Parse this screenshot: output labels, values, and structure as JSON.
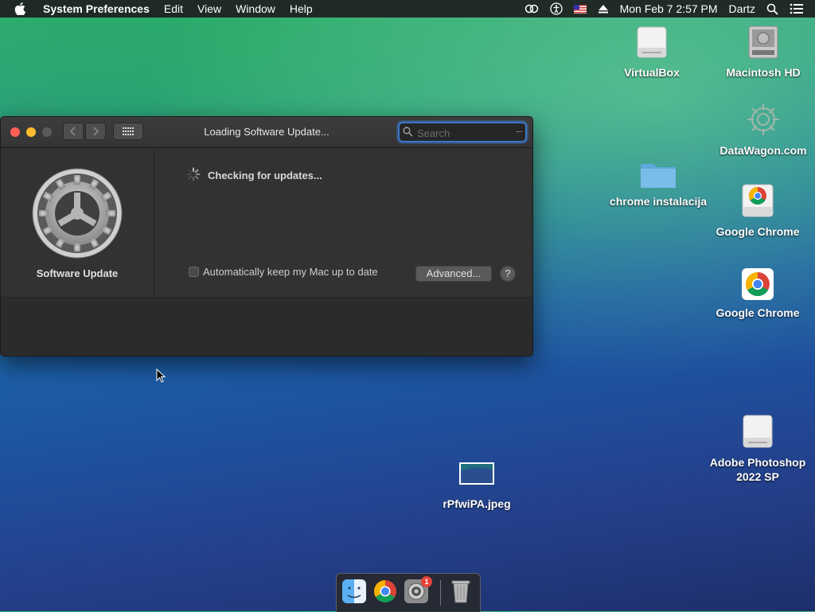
{
  "menubar": {
    "app_name": "System Preferences",
    "items": [
      "Edit",
      "View",
      "Window",
      "Help"
    ],
    "clock": "Mon Feb 7  2:57 PM",
    "user": "Dartz",
    "status_icons": [
      "creative-cloud-icon",
      "accessibility-icon",
      "us-flag-icon",
      "eject-icon",
      "search-icon",
      "list-icon"
    ]
  },
  "desktop": {
    "icons": [
      {
        "label": "VirtualBox",
        "icon": "drive-icon"
      },
      {
        "label": "Macintosh HD",
        "icon": "hard-disk-icon"
      },
      {
        "label": "DataWagon.com",
        "icon": "datawagon-icon"
      },
      {
        "label": "chrome instalacija",
        "icon": "folder-icon"
      },
      {
        "label": "Google Chrome",
        "icon": "chrome-drive-icon"
      },
      {
        "label": "Google Chrome",
        "icon": "chrome-icon"
      },
      {
        "label": "Adobe Photoshop 2022 SP",
        "icon": "drive-icon"
      },
      {
        "label": "rPfwiPA.jpeg",
        "icon": "image-file-icon"
      }
    ]
  },
  "window": {
    "title": "Loading Software Update...",
    "search": {
      "placeholder": "Search",
      "value": ""
    },
    "sidebar_label": "Software Update",
    "status_text": "Checking for updates...",
    "auto_update_label": "Automatically keep my Mac up to date",
    "auto_update_checked": false,
    "advanced_button": "Advanced...",
    "help_button": "?"
  },
  "dock": {
    "items": [
      "finder-icon",
      "chrome-icon",
      "system-preferences-icon",
      "trash-icon"
    ],
    "system_preferences_badge": "1"
  },
  "colors": {
    "window_bg": "#323232",
    "search_focus": "#3c78c8",
    "badge": "#e6443a"
  }
}
